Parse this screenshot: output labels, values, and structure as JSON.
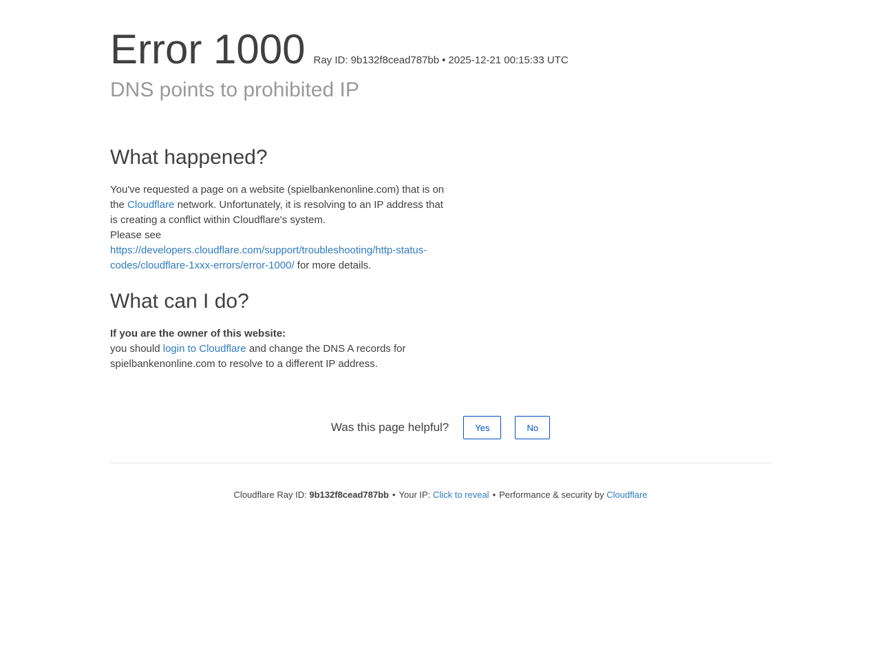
{
  "header": {
    "error_title": "Error 1000",
    "ray_id_label": "Ray ID: 9b132f8cead787bb",
    "separator": "•",
    "timestamp": "2025-12-21 00:15:33 UTC",
    "subtitle": "DNS points to prohibited IP"
  },
  "what_happened": {
    "heading": "What happened?",
    "text_1": "You've requested a page on a website (spielbankenonline.com) that is on the ",
    "cloudflare_link": "Cloudflare",
    "text_2": " network. Unfortunately, it is resolving to an IP address that is creating a conflict within Cloudflare's system.",
    "please_see": "Please see",
    "docs_link": "https://developers.cloudflare.com/support/troubleshooting/http-status-codes/cloudflare-1xxx-errors/error-1000/",
    "text_3": " for more details."
  },
  "what_can_i_do": {
    "heading": "What can I do?",
    "owner_label": "If you are the owner of this website:",
    "text_1": "you should ",
    "login_link": "login to Cloudflare",
    "text_2": " and change the DNS A records for spielbankenonline.com to resolve to a different IP address."
  },
  "feedback": {
    "question": "Was this page helpful?",
    "yes_label": "Yes",
    "no_label": "No"
  },
  "footer": {
    "ray_label": "Cloudflare Ray ID: ",
    "ray_value": "9b132f8cead787bb",
    "separator": "•",
    "ip_label": "Your IP: ",
    "ip_reveal": "Click to reveal",
    "perf_label": "Performance & security by ",
    "cloudflare_link": "Cloudflare"
  },
  "colors": {
    "text": "#404040",
    "subtitle": "#999999",
    "link": "#2f7bbf",
    "button": "#0051c3"
  }
}
